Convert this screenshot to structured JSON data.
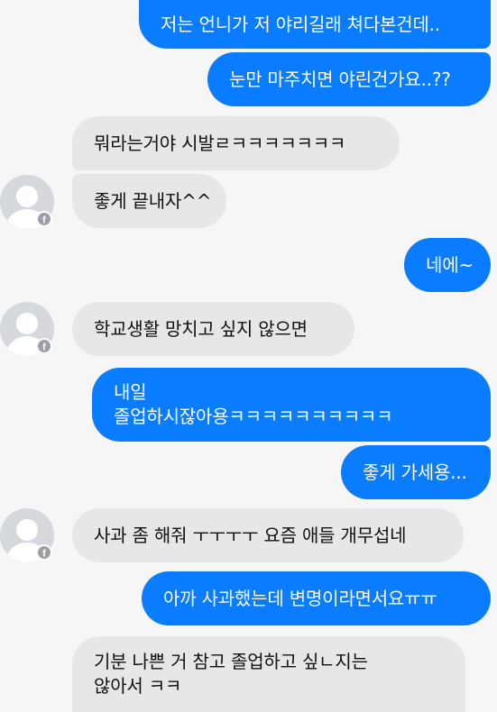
{
  "messages": [
    {
      "side": "out",
      "text": "저는 언니가 저 야리길래 쳐다본건데.."
    },
    {
      "side": "out",
      "text": "눈만 마주치면 야린건가요..??"
    },
    {
      "side": "in",
      "text": "뭐라는거야 시발ㄹㅋㅋㅋㅋㅋㅋㅋ"
    },
    {
      "side": "in",
      "text": "좋게 끝내자^^"
    },
    {
      "side": "out",
      "text": "네에~"
    },
    {
      "side": "in",
      "text": "학교생활 망치고 싶지 않으면"
    },
    {
      "side": "out",
      "lines": [
        "내일",
        "졸업하시잖아용ㅋㅋㅋㅋㅋㅋㅋㅋㅋㅋ"
      ]
    },
    {
      "side": "out",
      "text": "좋게 가세용..."
    },
    {
      "side": "in",
      "text": "사과 좀 해줘 ㅜㅜㅜㅜ 요즘 애들 개무섭네"
    },
    {
      "side": "out",
      "text": "아까 사과했는데 변명이라면서요ㅠㅠ"
    },
    {
      "side": "in",
      "lines": [
        "기분 나쁜 거 참고 졸업하고 싶ㄴ지는",
        "않아서 ㅋㅋ"
      ]
    }
  ],
  "avatar_icon": "default-profile-avatar-icon",
  "badge_icon": "facebook-badge-icon",
  "colors": {
    "outgoing_bubble": "#0a7cff",
    "incoming_bubble": "#e7e7ea",
    "background": "#f6f6f7",
    "facebook_badge": "#9aa0a6"
  }
}
